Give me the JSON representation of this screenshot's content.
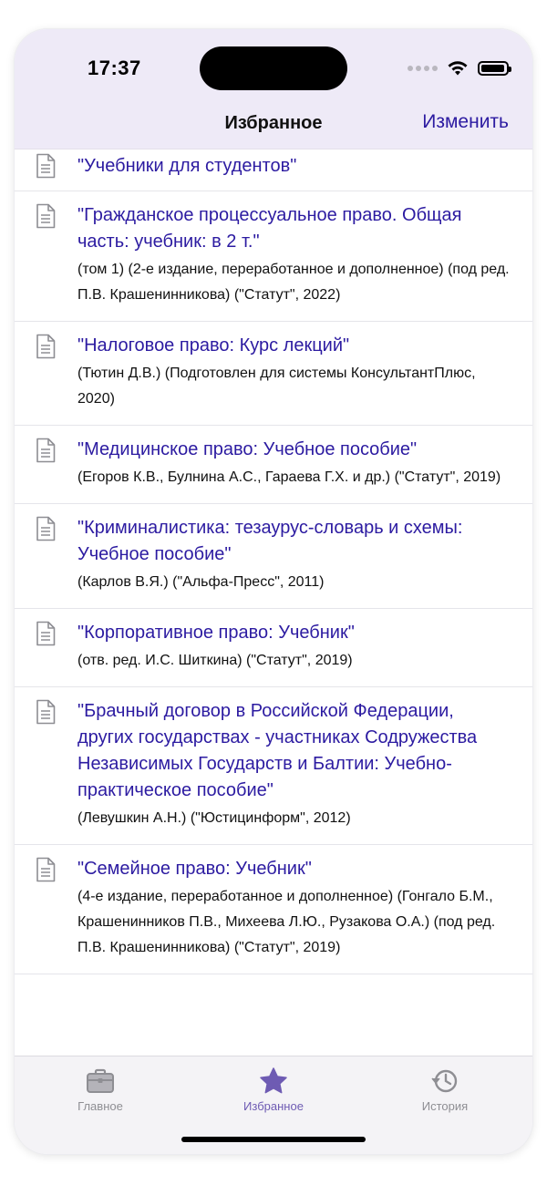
{
  "status": {
    "time": "17:37"
  },
  "nav": {
    "title": "Избранное",
    "edit_label": "Изменить"
  },
  "icons": {
    "document": "document-icon",
    "briefcase": "briefcase-icon",
    "star": "star-icon",
    "history": "history-icon",
    "wifi": "wifi-icon",
    "battery": "battery-icon"
  },
  "colors": {
    "accent": "#2c1ba1",
    "tab_active": "#6e5bb3",
    "tab_inactive": "#8e8e93",
    "header_bg": "#eeeaf7"
  },
  "items": [
    {
      "title": "\"Учебники для студентов\"",
      "subtitle": ""
    },
    {
      "title": "\"Гражданское процессуальное право. Общая часть: учебник: в 2 т.\"",
      "subtitle": "(том 1) (2-е издание, переработанное и дополненное) (под ред. П.В. Крашенинникова) (\"Статут\", 2022)"
    },
    {
      "title": "\"Налоговое право: Курс лекций\"",
      "subtitle": "(Тютин Д.В.) (Подготовлен для системы КонсультантПлюс, 2020)"
    },
    {
      "title": "\"Медицинское право: Учебное пособие\"",
      "subtitle": "(Егоров К.В., Булнина А.С., Гараева Г.Х. и др.) (\"Статут\", 2019)"
    },
    {
      "title": "\"Криминалистика: тезаурус-словарь и схемы: Учебное пособие\"",
      "subtitle": "(Карлов В.Я.) (\"Альфа-Пресс\", 2011)"
    },
    {
      "title": "\"Корпоративное право: Учебник\"",
      "subtitle": "(отв. ред. И.С. Шиткина) (\"Статут\", 2019)"
    },
    {
      "title": "\"Брачный договор в Российской Федерации, других государствах - участниках Содружества Независимых Государств и Балтии: Учебно-практическое пособие\"",
      "subtitle": "(Левушкин А.Н.) (\"Юстицинформ\", 2012)"
    },
    {
      "title": "\"Семейное право: Учебник\"",
      "subtitle": "(4-е издание, переработанное и дополненное) (Гонгало Б.М., Крашенинников П.В., Михеева Л.Ю., Рузакова О.А.) (под ред. П.В. Крашенинникова) (\"Статут\", 2019)"
    }
  ],
  "tabs": [
    {
      "label": "Главное",
      "icon": "briefcase-icon",
      "active": false
    },
    {
      "label": "Избранное",
      "icon": "star-icon",
      "active": true
    },
    {
      "label": "История",
      "icon": "history-icon",
      "active": false
    }
  ]
}
